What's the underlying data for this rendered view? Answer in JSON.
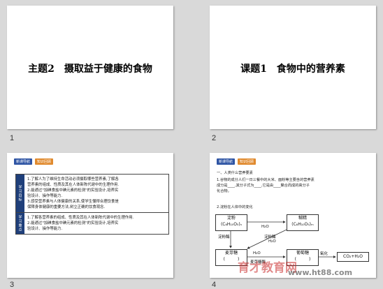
{
  "slides": [
    {
      "number": "1",
      "title": "主题2　摄取益于健康的食物"
    },
    {
      "number": "2",
      "title": "课题1　食物中的营养素"
    },
    {
      "number": "3",
      "tabs": [
        "新课导航",
        "知识回顾"
      ],
      "rows": [
        {
          "head": "学习目标",
          "lines": [
            "1.了解人为了维持生命活动必须摄取哪些营养素,了解各",
            "营养素的组成、性质及其在人体新陈代谢中的生理作用.",
            "2.能通过\"加碘食盐中碘元素的检测\"的实验设计,培养实",
            "验设计、操作等能力.",
            "3.感受营养素与人体健康的关系,使学生懂得合理饮食是",
            "保障身体健康的重要方法,树立正确的饮食观念."
          ]
        },
        {
          "head": "学习重点",
          "lines": [
            "1.了解各营养素的组成、性质及其在人体新陈代谢中的生理作用.",
            "2.能通过\"加碘食盐中碘元素的检测\"的实验设计,培养实",
            "验设计、操作等能力."
          ]
        }
      ]
    },
    {
      "number": "4",
      "tabs": [
        "新课导航",
        "知识回顾"
      ],
      "section": "一、人类什么营养要素",
      "para": [
        "1.谷物的成分人们一日三餐中的大米、面粉等主要含的营养素",
        "成分是____,其分子式为____,它是由____聚合而成的高分子",
        "化合物。"
      ],
      "sub": "2.淀粉在人体中的变化",
      "diagram": {
        "starch": [
          "淀粉",
          "(C₆H₁₀O₅)ₙ"
        ],
        "dextrin": [
          "糊精",
          "(C₆H₁₀O₅)ₘ"
        ],
        "maltose": [
          "麦芽糖",
          "(　　　)"
        ],
        "glucose": [
          "葡萄糖",
          "(　　　)"
        ],
        "h2o_1": "H₂O",
        "h2o_2": "H₂O",
        "h2o_3": "H₂O",
        "enzyme1": "淀粉酶",
        "enzyme2": "淀粉酶",
        "enzyme3": "麦芽糖酶",
        "oxidation": "氧化",
        "product": "CO₂+H₂O"
      }
    }
  ],
  "watermark": {
    "brand": "育才教育网",
    "url": "www.ht88.com"
  }
}
